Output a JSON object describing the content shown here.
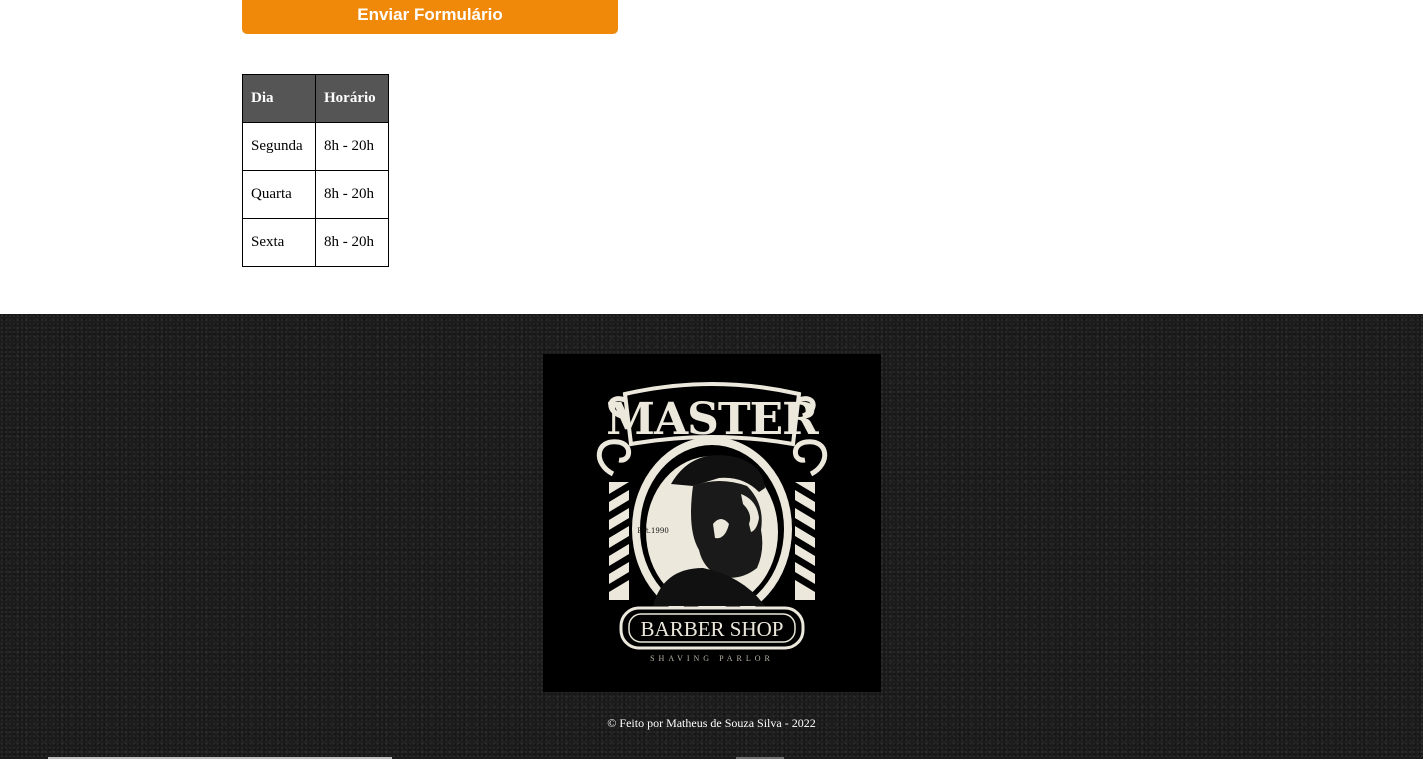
{
  "form": {
    "submit_label": "Enviar Formulário"
  },
  "schedule": {
    "headers": [
      "Dia",
      "Horário"
    ],
    "rows": [
      [
        "Segunda",
        "8h - 20h"
      ],
      [
        "Quarta",
        "8h - 20h"
      ],
      [
        "Sexta",
        "8h - 20h"
      ]
    ]
  },
  "footer": {
    "logo": {
      "name": "master-barber-shop-logo",
      "text_top": "MASTER",
      "text_est": "Est.1990",
      "text_main": "BARBER SHOP",
      "text_sub": "SHAVING PARLOR"
    },
    "copyright": "© Feito por Matheus de Souza Silva - 2022"
  },
  "colors": {
    "button": "#f0890a",
    "table_header": "#555555",
    "footer_bg": "#1c1c1c",
    "logo_cream": "#ece8dc"
  }
}
